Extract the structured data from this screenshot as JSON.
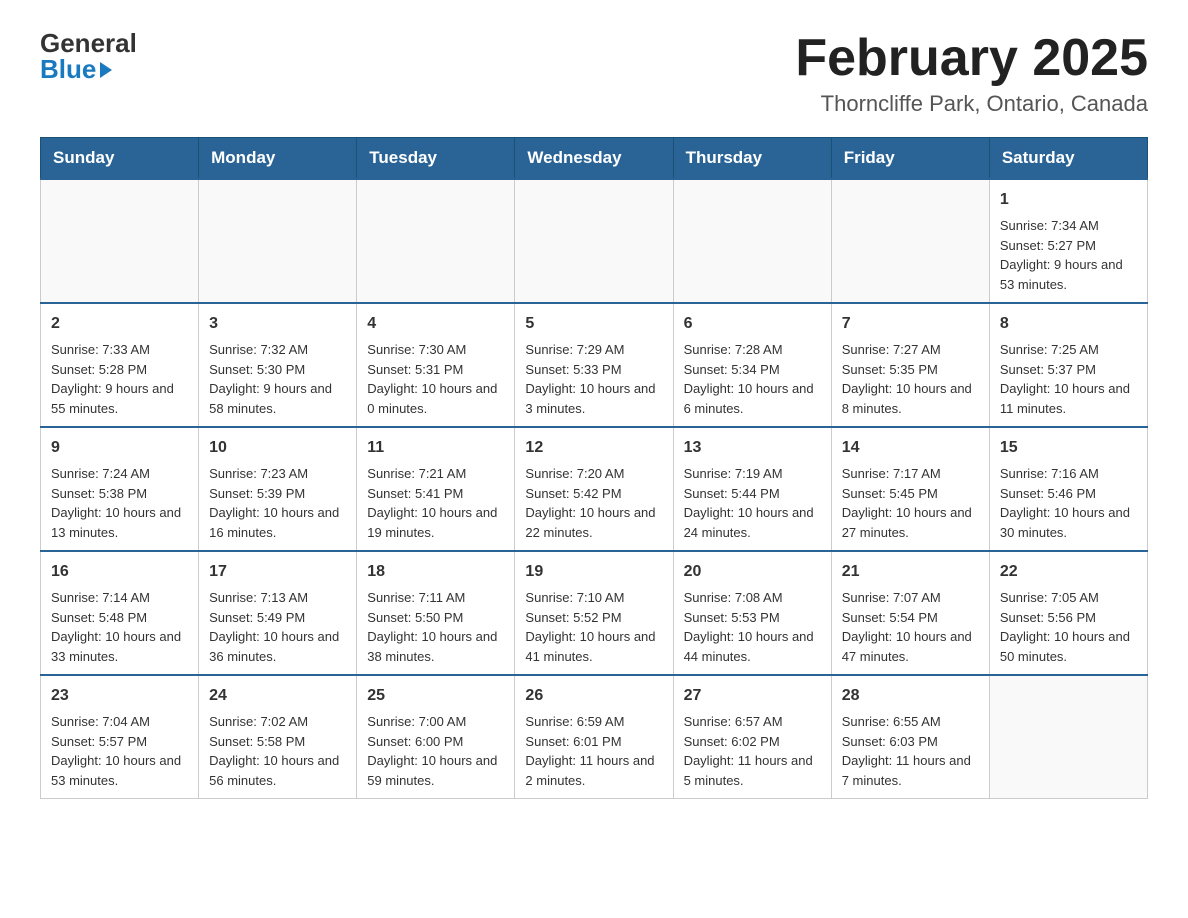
{
  "header": {
    "logo_general": "General",
    "logo_blue": "Blue",
    "month_title": "February 2025",
    "location": "Thorncliffe Park, Ontario, Canada"
  },
  "days_of_week": [
    "Sunday",
    "Monday",
    "Tuesday",
    "Wednesday",
    "Thursday",
    "Friday",
    "Saturday"
  ],
  "weeks": [
    [
      {
        "day": "",
        "info": ""
      },
      {
        "day": "",
        "info": ""
      },
      {
        "day": "",
        "info": ""
      },
      {
        "day": "",
        "info": ""
      },
      {
        "day": "",
        "info": ""
      },
      {
        "day": "",
        "info": ""
      },
      {
        "day": "1",
        "info": "Sunrise: 7:34 AM\nSunset: 5:27 PM\nDaylight: 9 hours and 53 minutes."
      }
    ],
    [
      {
        "day": "2",
        "info": "Sunrise: 7:33 AM\nSunset: 5:28 PM\nDaylight: 9 hours and 55 minutes."
      },
      {
        "day": "3",
        "info": "Sunrise: 7:32 AM\nSunset: 5:30 PM\nDaylight: 9 hours and 58 minutes."
      },
      {
        "day": "4",
        "info": "Sunrise: 7:30 AM\nSunset: 5:31 PM\nDaylight: 10 hours and 0 minutes."
      },
      {
        "day": "5",
        "info": "Sunrise: 7:29 AM\nSunset: 5:33 PM\nDaylight: 10 hours and 3 minutes."
      },
      {
        "day": "6",
        "info": "Sunrise: 7:28 AM\nSunset: 5:34 PM\nDaylight: 10 hours and 6 minutes."
      },
      {
        "day": "7",
        "info": "Sunrise: 7:27 AM\nSunset: 5:35 PM\nDaylight: 10 hours and 8 minutes."
      },
      {
        "day": "8",
        "info": "Sunrise: 7:25 AM\nSunset: 5:37 PM\nDaylight: 10 hours and 11 minutes."
      }
    ],
    [
      {
        "day": "9",
        "info": "Sunrise: 7:24 AM\nSunset: 5:38 PM\nDaylight: 10 hours and 13 minutes."
      },
      {
        "day": "10",
        "info": "Sunrise: 7:23 AM\nSunset: 5:39 PM\nDaylight: 10 hours and 16 minutes."
      },
      {
        "day": "11",
        "info": "Sunrise: 7:21 AM\nSunset: 5:41 PM\nDaylight: 10 hours and 19 minutes."
      },
      {
        "day": "12",
        "info": "Sunrise: 7:20 AM\nSunset: 5:42 PM\nDaylight: 10 hours and 22 minutes."
      },
      {
        "day": "13",
        "info": "Sunrise: 7:19 AM\nSunset: 5:44 PM\nDaylight: 10 hours and 24 minutes."
      },
      {
        "day": "14",
        "info": "Sunrise: 7:17 AM\nSunset: 5:45 PM\nDaylight: 10 hours and 27 minutes."
      },
      {
        "day": "15",
        "info": "Sunrise: 7:16 AM\nSunset: 5:46 PM\nDaylight: 10 hours and 30 minutes."
      }
    ],
    [
      {
        "day": "16",
        "info": "Sunrise: 7:14 AM\nSunset: 5:48 PM\nDaylight: 10 hours and 33 minutes."
      },
      {
        "day": "17",
        "info": "Sunrise: 7:13 AM\nSunset: 5:49 PM\nDaylight: 10 hours and 36 minutes."
      },
      {
        "day": "18",
        "info": "Sunrise: 7:11 AM\nSunset: 5:50 PM\nDaylight: 10 hours and 38 minutes."
      },
      {
        "day": "19",
        "info": "Sunrise: 7:10 AM\nSunset: 5:52 PM\nDaylight: 10 hours and 41 minutes."
      },
      {
        "day": "20",
        "info": "Sunrise: 7:08 AM\nSunset: 5:53 PM\nDaylight: 10 hours and 44 minutes."
      },
      {
        "day": "21",
        "info": "Sunrise: 7:07 AM\nSunset: 5:54 PM\nDaylight: 10 hours and 47 minutes."
      },
      {
        "day": "22",
        "info": "Sunrise: 7:05 AM\nSunset: 5:56 PM\nDaylight: 10 hours and 50 minutes."
      }
    ],
    [
      {
        "day": "23",
        "info": "Sunrise: 7:04 AM\nSunset: 5:57 PM\nDaylight: 10 hours and 53 minutes."
      },
      {
        "day": "24",
        "info": "Sunrise: 7:02 AM\nSunset: 5:58 PM\nDaylight: 10 hours and 56 minutes."
      },
      {
        "day": "25",
        "info": "Sunrise: 7:00 AM\nSunset: 6:00 PM\nDaylight: 10 hours and 59 minutes."
      },
      {
        "day": "26",
        "info": "Sunrise: 6:59 AM\nSunset: 6:01 PM\nDaylight: 11 hours and 2 minutes."
      },
      {
        "day": "27",
        "info": "Sunrise: 6:57 AM\nSunset: 6:02 PM\nDaylight: 11 hours and 5 minutes."
      },
      {
        "day": "28",
        "info": "Sunrise: 6:55 AM\nSunset: 6:03 PM\nDaylight: 11 hours and 7 minutes."
      },
      {
        "day": "",
        "info": ""
      }
    ]
  ]
}
